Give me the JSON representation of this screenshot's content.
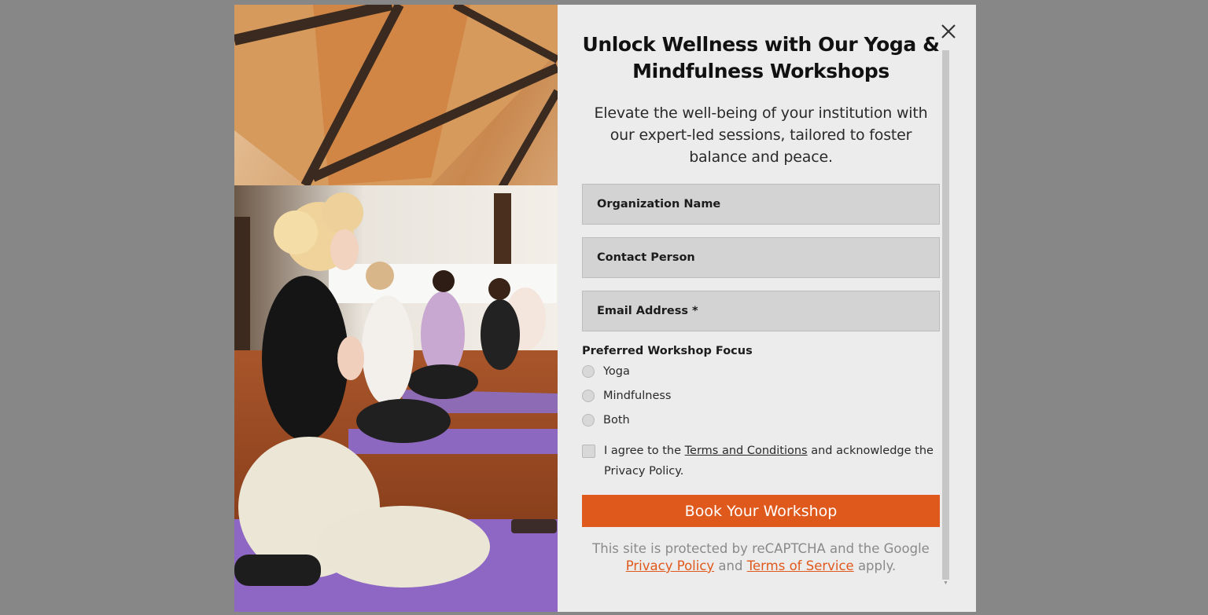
{
  "modal": {
    "title": "Unlock Wellness with Our Yoga & Mindfulness Workshops",
    "subtitle": "Elevate the well-being of your institution with our expert-led sessions, tailored to foster balance and peace.",
    "close_icon": "close-icon",
    "fields": {
      "organization": {
        "placeholder": "Organization Name",
        "value": ""
      },
      "contact": {
        "placeholder": "Contact Person",
        "value": ""
      },
      "email": {
        "placeholder": "Email Address *",
        "value": ""
      }
    },
    "focus": {
      "label": "Preferred Workshop Focus",
      "options": [
        "Yoga",
        "Mindfulness",
        "Both"
      ]
    },
    "agree": {
      "before": "I agree to the ",
      "link": "Terms and Conditions",
      "after": " and acknowledge the Privacy Policy."
    },
    "submit_label": "Book Your Workshop",
    "recaptcha": {
      "line1": "This site is protected by reCAPTCHA and the Google",
      "privacy_link": "Privacy Policy",
      "and": " and ",
      "terms_link": "Terms of Service",
      "apply": " apply."
    }
  },
  "colors": {
    "backdrop": "#878787",
    "panel": "#ececec",
    "input_bg": "#d3d3d3",
    "accent": "#e0591c"
  }
}
